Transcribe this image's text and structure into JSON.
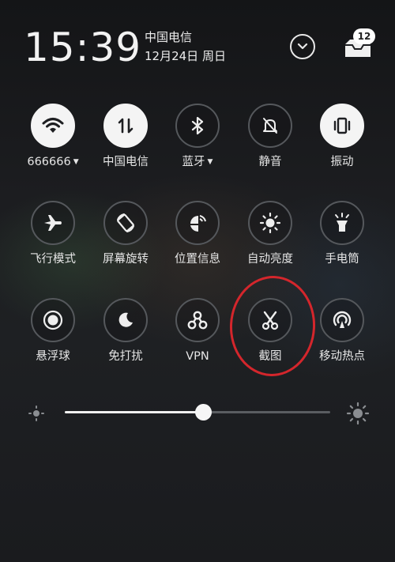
{
  "status": {
    "time": "15:39",
    "carrier": "中国电信",
    "date": "12月24日 周日",
    "notification_count": "12"
  },
  "colors": {
    "tile_on": "#f4f4f4",
    "tile_border": "#55585c",
    "annotation_circle": "#d4262c",
    "slider_fill": "#f0f0f0"
  },
  "tiles": [
    {
      "label": "666666",
      "icon": "wifi-icon",
      "active": true,
      "dropdown": true
    },
    {
      "label": "中国电信",
      "icon": "mobile-data-icon",
      "active": true,
      "dropdown": false
    },
    {
      "label": "蓝牙",
      "icon": "bluetooth-icon",
      "active": false,
      "dropdown": true
    },
    {
      "label": "静音",
      "icon": "bell-mute-icon",
      "active": false,
      "dropdown": false
    },
    {
      "label": "振动",
      "icon": "vibrate-icon",
      "active": true,
      "dropdown": false
    },
    {
      "label": "飞行模式",
      "icon": "airplane-icon",
      "active": false,
      "dropdown": false
    },
    {
      "label": "屏幕旋转",
      "icon": "rotate-icon",
      "active": false,
      "dropdown": false
    },
    {
      "label": "位置信息",
      "icon": "location-icon",
      "active": false,
      "dropdown": false
    },
    {
      "label": "自动亮度",
      "icon": "auto-brightness-icon",
      "active": false,
      "dropdown": false
    },
    {
      "label": "手电筒",
      "icon": "flashlight-icon",
      "active": false,
      "dropdown": false
    },
    {
      "label": "悬浮球",
      "icon": "floating-ball-icon",
      "active": false,
      "dropdown": false
    },
    {
      "label": "免打扰",
      "icon": "moon-icon",
      "active": false,
      "dropdown": false
    },
    {
      "label": "VPN",
      "icon": "vpn-icon",
      "active": false,
      "dropdown": false
    },
    {
      "label": "截图",
      "icon": "scissors-icon",
      "active": false,
      "dropdown": false
    },
    {
      "label": "移动热点",
      "icon": "hotspot-icon",
      "active": false,
      "dropdown": false
    }
  ],
  "brightness": {
    "level": 0.52
  }
}
